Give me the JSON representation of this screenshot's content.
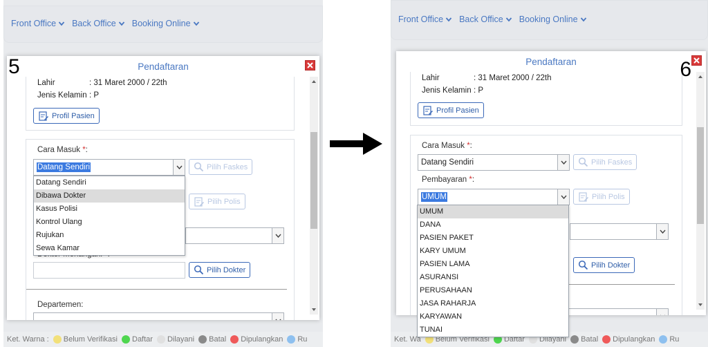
{
  "nav": [
    "Front Office",
    "Back Office",
    "Booking Online"
  ],
  "legend_label": "Ket. Warna :",
  "legend": [
    {
      "label": "Belum Verifikasi",
      "color": "#f2e07a"
    },
    {
      "label": "Daftar",
      "color": "#4fd64f"
    },
    {
      "label": "Dilayani",
      "color": "#e0e0e0"
    },
    {
      "label": "Batal",
      "color": "#8a8a8a"
    },
    {
      "label": "Dipulangkan",
      "color": "#ef5a5a"
    },
    {
      "label": "Ru",
      "color": "#8ec0ef"
    }
  ],
  "legend_right_label": "Ket. Wa",
  "dialog_title": "Pendaftaran",
  "patient": {
    "lahir_label": "Lahir",
    "lahir_value": ": 31 Maret 2000 / 22th",
    "jk_label": "Jenis Kelamin",
    "jk_value": ": P"
  },
  "buttons": {
    "profil": "Profil Pasien",
    "faskes": "Pilih Faskes",
    "polis": "Pilih Polis",
    "dokter": "Pilih Dokter"
  },
  "labels": {
    "cara_masuk": "Cara Masuk ",
    "pembayaran": "Pembayaran ",
    "dokter_menangani": "Dokter Menangani ",
    "departemen": "Departemen:",
    "required_mark": "*",
    "colon": ":"
  },
  "left": {
    "step": "5",
    "cara_masuk_value": "Datang Sendiri",
    "cara_masuk_options": [
      "Datang Sendiri",
      "Dibawa Dokter",
      "Kasus Polisi",
      "Kontrol Ulang",
      "Rujukan",
      "Sewa Kamar"
    ],
    "selected_index": 1
  },
  "right": {
    "step": "6",
    "cara_masuk_value": "Datang Sendiri",
    "pembayaran_value": "UMUM",
    "pembayaran_options": [
      "UMUM",
      "DANA",
      "PASIEN PAKET",
      "KARY UMUM",
      "PASIEN LAMA",
      "ASURANSI",
      "PERUSAHAAN",
      "JASA RAHARJA",
      "KARYAWAN",
      "TUNAI"
    ],
    "selected_index": 0
  },
  "colors": {
    "accent": "#4a78c2",
    "close": "#d93a3a",
    "highlight": "#3b7ae0"
  }
}
